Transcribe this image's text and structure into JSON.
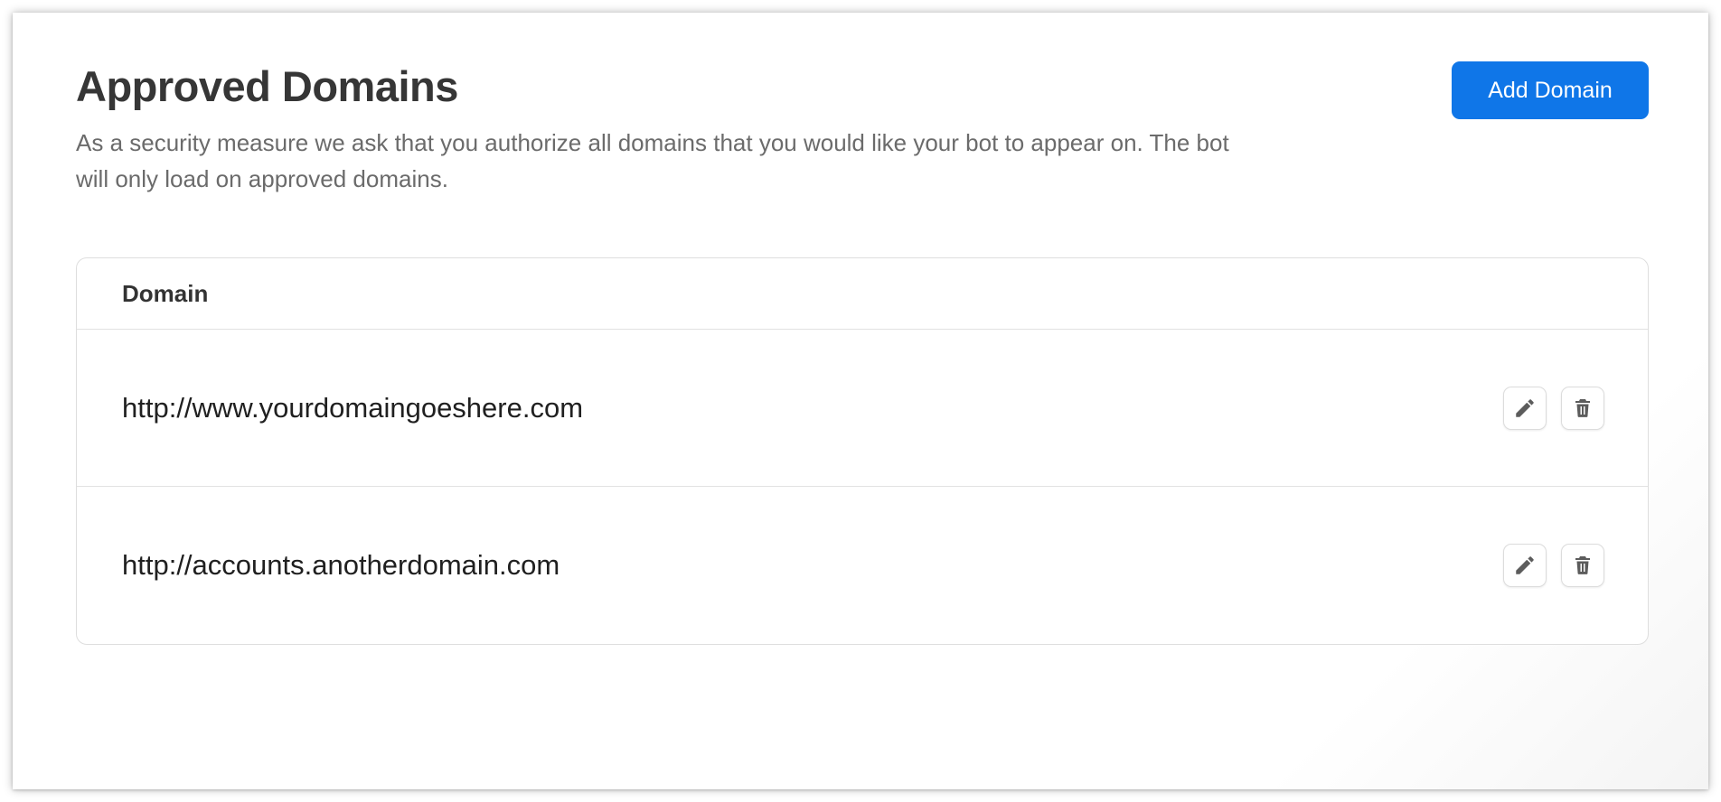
{
  "page": {
    "title": "Approved Domains",
    "description": "As a security measure we ask that you authorize all domains that you would like your bot to appear on. The bot will only load on approved domains."
  },
  "toolbar": {
    "add_label": "Add Domain"
  },
  "table": {
    "columns": [
      "Domain"
    ],
    "rows": [
      {
        "domain": "http://www.yourdomaingoeshere.com"
      },
      {
        "domain": "http://accounts.anotherdomain.com"
      }
    ]
  },
  "icons": {
    "edit": "pencil-icon",
    "delete": "trash-icon"
  },
  "colors": {
    "accent": "#0f76e8",
    "title": "#363636",
    "muted_text": "#6b6b6b",
    "icon": "#5c5c5c"
  }
}
